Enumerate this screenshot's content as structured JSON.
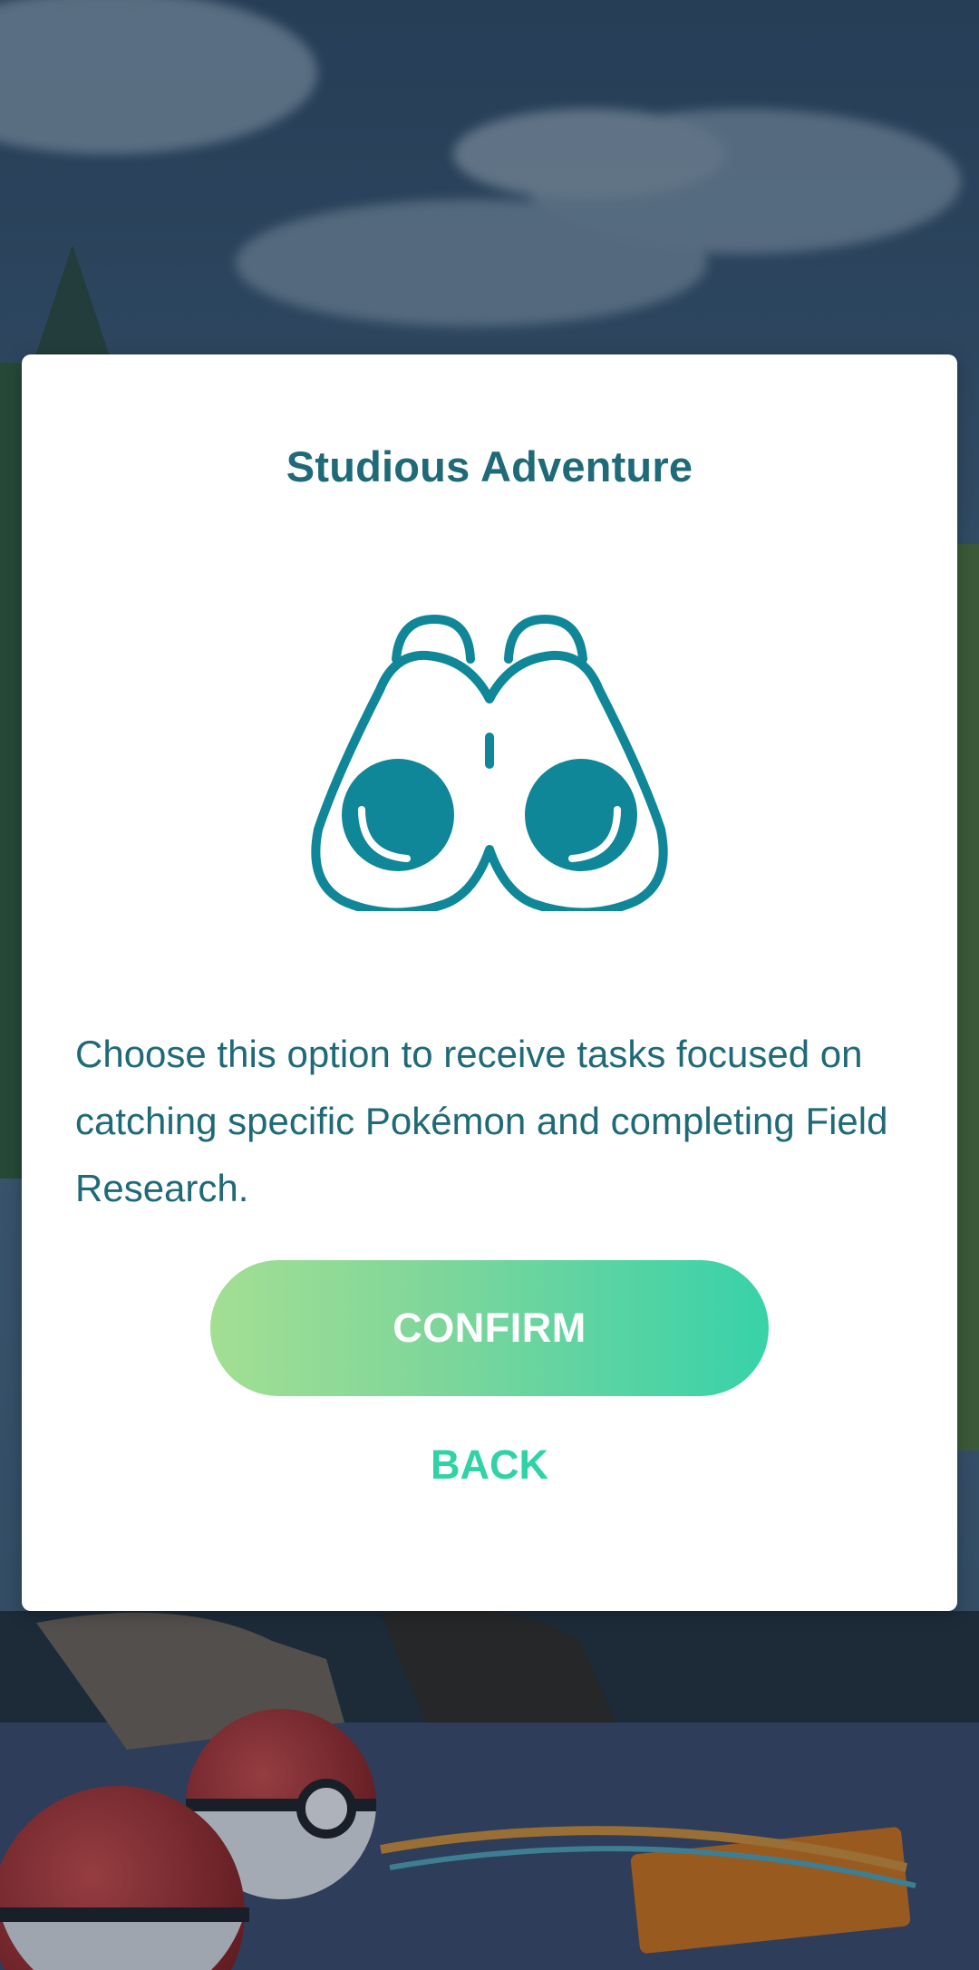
{
  "dialog": {
    "title": "Studious Adventure",
    "icon": "binoculars-icon",
    "description": "Choose this option to receive tasks focused on catching specific Pokémon and completing Field Research.",
    "confirm_label": "CONFIRM",
    "back_label": "BACK"
  },
  "colors": {
    "title_text": "#1f6a78",
    "icon": "#0f8799",
    "confirm_gradient_start": "#a3df93",
    "confirm_gradient_end": "#38d2a9",
    "back_text": "#2fd3a6",
    "dialog_background": "#ffffff"
  }
}
